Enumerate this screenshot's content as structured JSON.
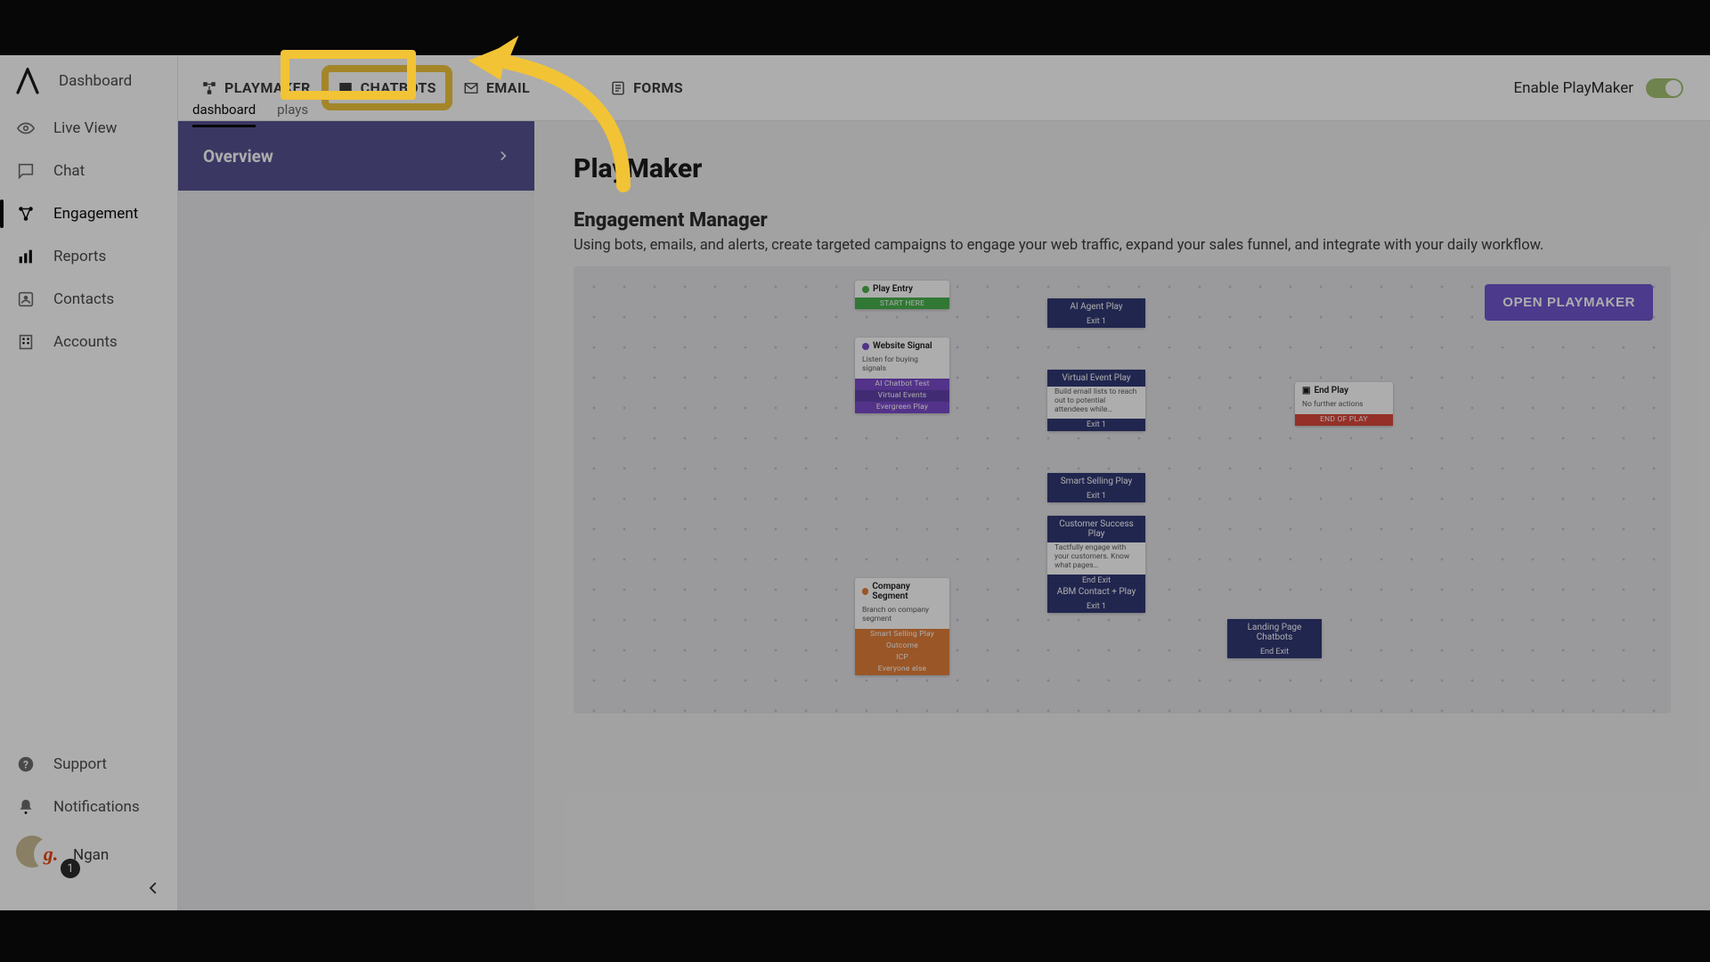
{
  "sidebar": {
    "nav": [
      {
        "label": "Dashboard"
      },
      {
        "label": "Live View"
      },
      {
        "label": "Chat"
      },
      {
        "label": "Engagement"
      },
      {
        "label": "Reports"
      },
      {
        "label": "Contacts"
      },
      {
        "label": "Accounts"
      }
    ],
    "bottom": [
      {
        "label": "Support"
      },
      {
        "label": "Notifications"
      }
    ],
    "user": {
      "name": "Ngan",
      "badge": "1",
      "g": "g."
    }
  },
  "header": {
    "tabs": [
      {
        "label": "PLAYMAKER"
      },
      {
        "label": "CHATBOTS"
      },
      {
        "label": "EMAIL"
      },
      {
        "label": "FORMS"
      }
    ],
    "subtabs": [
      {
        "label": "dashboard"
      },
      {
        "label": "plays"
      }
    ],
    "enable_label": "Enable PlayMaker"
  },
  "rail": {
    "overview_label": "Overview"
  },
  "main": {
    "title": "PlayMaker",
    "subtitle": "Engagement Manager",
    "description": "Using bots, emails, and alerts, create targeted campaigns to engage your web traffic, expand your sales funnel, and integrate with your daily workflow.",
    "open_button": "OPEN PLAYMAKER"
  },
  "flow": {
    "play_entry": {
      "title": "Play Entry",
      "strip": "START HERE"
    },
    "website_signal": {
      "title": "Website Signal",
      "sub": "Listen for buying signals",
      "strips": [
        "AI Chatbot Test",
        "Virtual Events",
        "Evergreen Play"
      ]
    },
    "company_segment": {
      "title": "Company Segment",
      "sub": "Branch on company segment",
      "strips": [
        "Smart Selling Play",
        "Outcome",
        "ICP",
        "Everyone else"
      ]
    },
    "ai_agent": {
      "title": "AI Agent Play",
      "exit": "Exit 1"
    },
    "virtual_event": {
      "title": "Virtual Event Play",
      "sub": "Build email lists to reach out to potential attendees while…",
      "exit": "Exit 1"
    },
    "smart_selling": {
      "title": "Smart Selling Play",
      "exit": "Exit 1"
    },
    "customer_success": {
      "title": "Customer Success Play",
      "sub": "Tactfully engage with your customers. Know what pages…",
      "exit": "End Exit"
    },
    "abm": {
      "title": "ABM Contact + Play",
      "exit": "Exit 1"
    },
    "landing": {
      "title": "Landing Page Chatbots",
      "exit": "End Exit"
    },
    "end_play": {
      "title": "End Play",
      "sub": "No further actions",
      "strip": "END OF PLAY"
    }
  }
}
